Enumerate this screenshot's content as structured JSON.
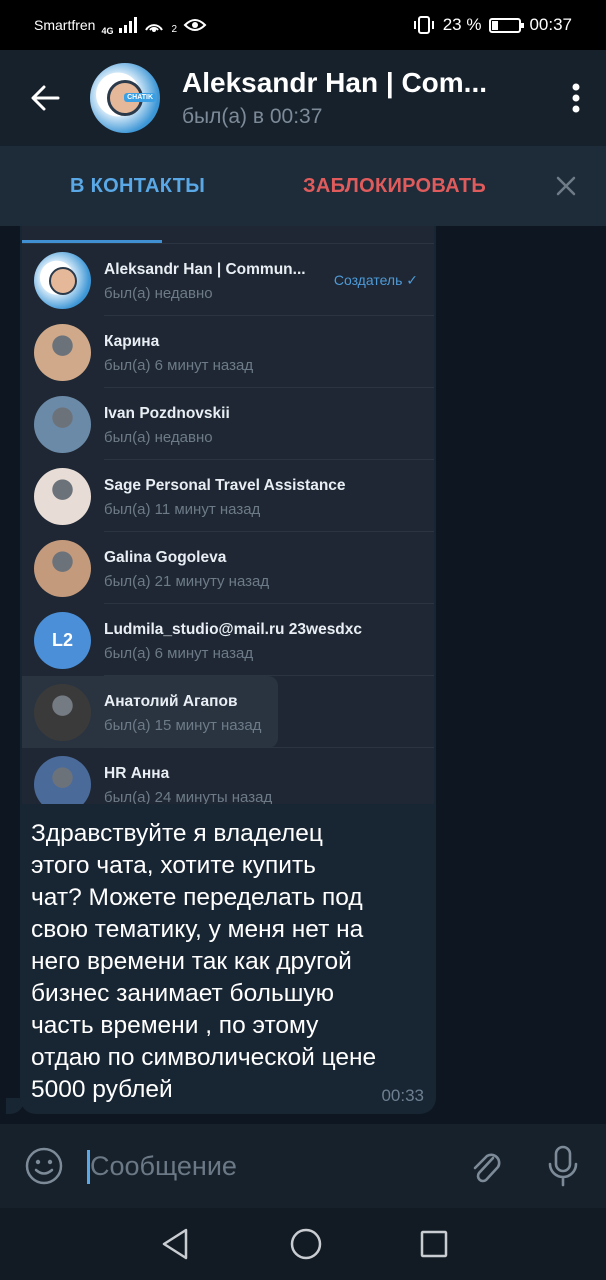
{
  "status_bar": {
    "carrier": "Smartfren",
    "network": "4G",
    "hotspot_count": "2",
    "battery": "23 %",
    "battery_level_pct": 23,
    "time": "00:37"
  },
  "header": {
    "title": "Aleksandr Han | Com...",
    "status": "был(а) в 00:37",
    "avatar_tag": "CHATIK"
  },
  "action_bar": {
    "add_contact": "В КОНТАКТЫ",
    "block": "ЗАБЛОКИРОВАТЬ"
  },
  "members": [
    {
      "name": "Aleksandr Han | Commun...",
      "seen": "был(а) недавно",
      "role": "Создатель ✓",
      "avatar": "logo"
    },
    {
      "name": "Карина",
      "seen": "был(а) 6 минут назад",
      "role": "",
      "avatar": "photo",
      "color": "#cfa98a"
    },
    {
      "name": "Ivan Pozdnovskii",
      "seen": "был(а) недавно",
      "role": "",
      "avatar": "photo",
      "color": "#6b8aa8"
    },
    {
      "name": "Sage Personal Travel Assistance",
      "seen": "был(а) 11 минут назад",
      "role": "",
      "avatar": "photo",
      "color": "#e8dcd6"
    },
    {
      "name": "Galina Gogoleva",
      "seen": "был(а) 21 минуту назад",
      "role": "",
      "avatar": "photo",
      "color": "#c49a7c"
    },
    {
      "name": "Ludmila_studio@mail.ru 23wesdxc",
      "seen": "был(а) 6 минут назад",
      "role": "",
      "avatar": "initials",
      "initials": "L2",
      "color": "#4a8fd8"
    },
    {
      "name": "Анатолий Агапов",
      "seen": "был(а) 15 минут назад",
      "role": "",
      "avatar": "photo",
      "color": "#3a3a3a"
    },
    {
      "name": "HR Анна",
      "seen": "был(а) 24 минуты назад",
      "role": "",
      "avatar": "photo",
      "color": "#4a6a9a"
    }
  ],
  "message": {
    "text": "Здравствуйте я владелец\nэтого чата, хотите купить\nчат? Можете переделать под\nсвою тематику, у меня нет на\nнего времени так как другой\nбизнес занимает большую\nчасть времени , по этому\nотдаю по символической цене\n5000 рублей",
    "time": "00:33"
  },
  "input": {
    "placeholder": "Сообщение"
  },
  "colors": {
    "accent": "#5aa9e6",
    "danger": "#e05c5c",
    "header_bg": "#17212b",
    "chat_bg": "#0e1621",
    "bubble_bg": "#182533"
  },
  "icons": {
    "back": "arrow-left-icon",
    "menu": "more-vertical-icon",
    "close": "close-icon",
    "emoji": "smile-icon",
    "attach": "paperclip-icon",
    "mic": "microphone-icon"
  }
}
